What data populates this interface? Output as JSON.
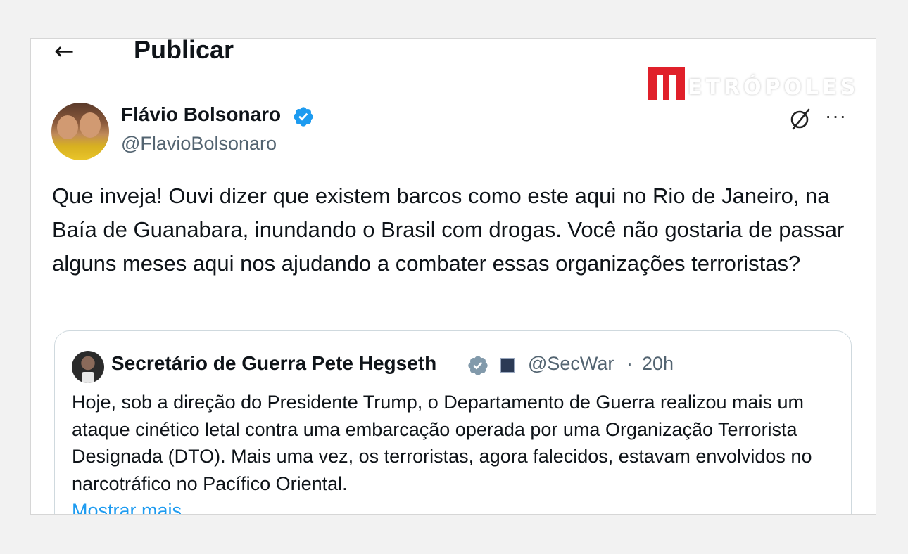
{
  "header": {
    "back_icon": "←",
    "title": "Publicar"
  },
  "watermark": {
    "brand": "METRÓPOLES",
    "logo_letter": "M",
    "display_text": "ETRÓPOLES",
    "color": "#e0202a"
  },
  "post": {
    "author_name": "Flávio Bolsonaro",
    "author_handle": "@FlavioBolsonaro",
    "verified_color": "#1d9bf0",
    "grok_icon": "Ø",
    "more_icon": "···",
    "text": "Que inveja! Ouvi dizer que existem barcos como este aqui no Rio de Janeiro, na Baía de Guanabara, inundando o Brasil com drogas. Você não gostaria de passar alguns meses aqui nos ajudando a combater essas organizações terroristas?"
  },
  "quote": {
    "author_name": "Secretário de Guerra Pete Hegseth",
    "author_handle": "@SecWar",
    "separator": "·",
    "time": "20h",
    "badge_color": "#829aab",
    "text": "Hoje, sob a direção do Presidente Trump, o Departamento de Guerra realizou mais um ataque cinético letal contra uma embarcação operada por uma Organização Terrorista Designada (DTO). Mais uma vez, os terroristas, agora falecidos, estavam envolvidos no narcotráfico no Pacífico Oriental.",
    "show_more": "Mostrar mais"
  }
}
